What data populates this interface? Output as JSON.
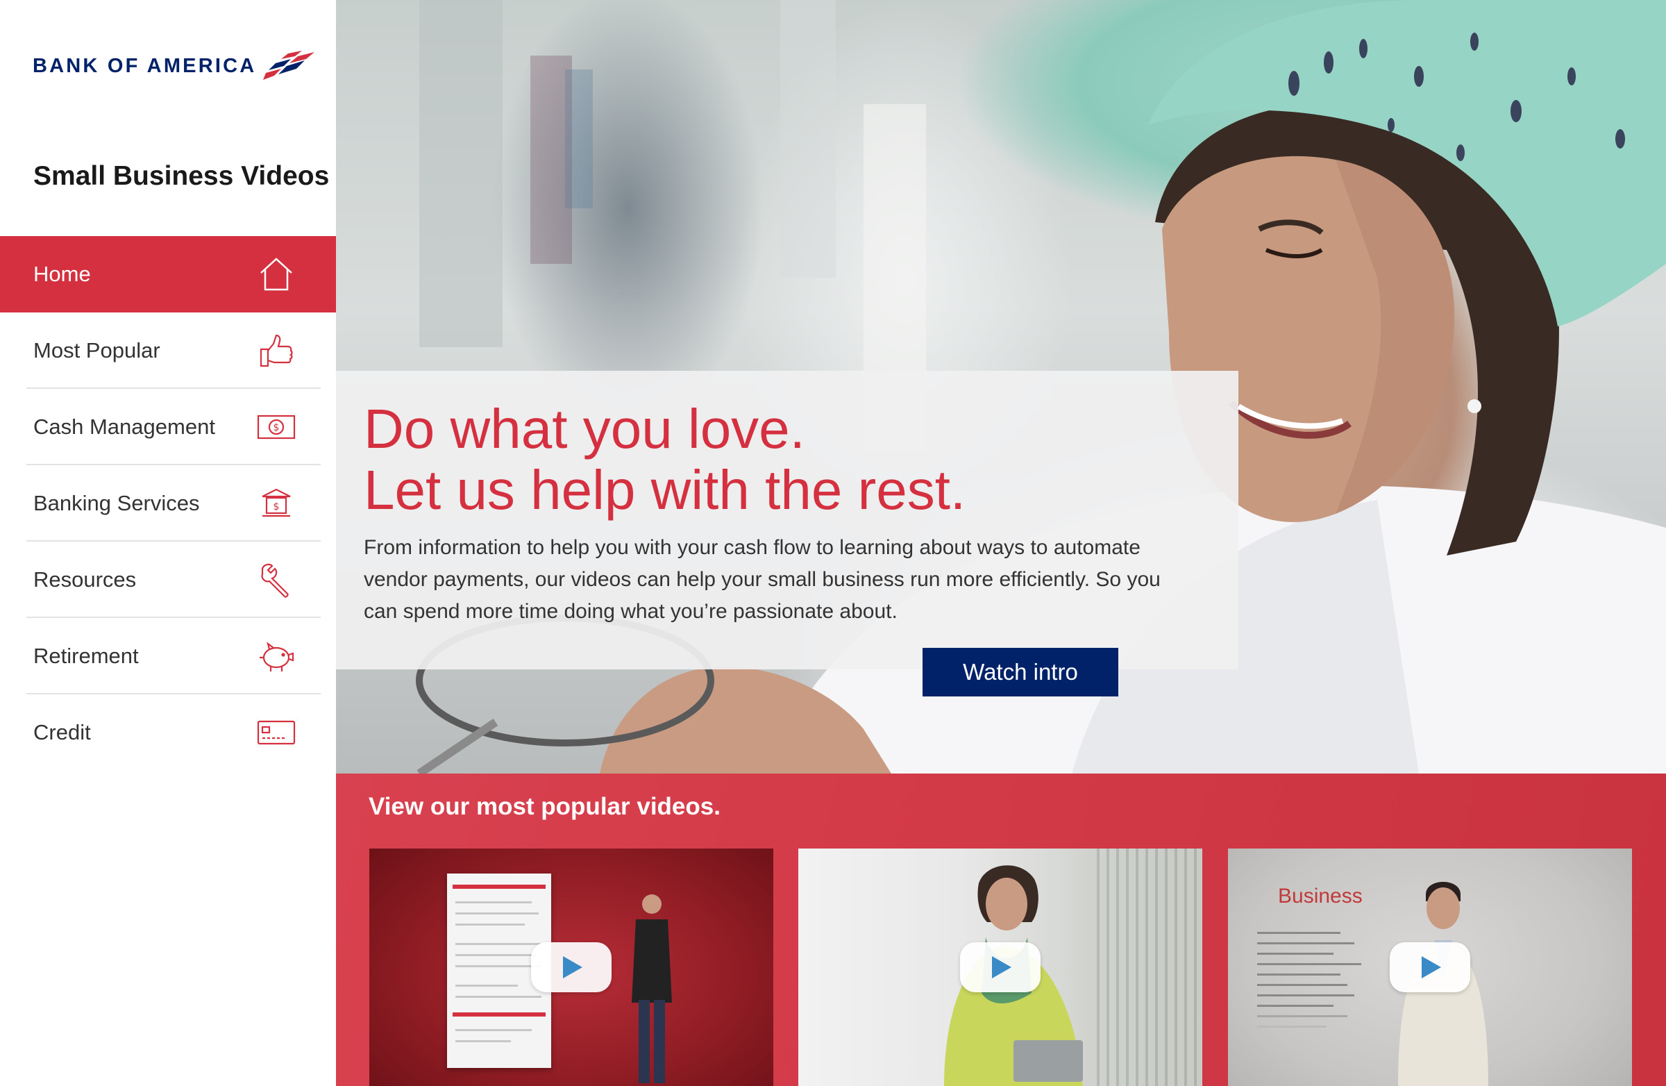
{
  "brand": {
    "name": "BANK OF AMERICA"
  },
  "sidebar": {
    "title": "Small Business Videos",
    "items": [
      {
        "label": "Home",
        "icon": "home-icon",
        "active": true
      },
      {
        "label": "Most Popular",
        "icon": "thumbs-up-icon",
        "active": false
      },
      {
        "label": "Cash Management",
        "icon": "cash-icon",
        "active": false
      },
      {
        "label": "Banking Services",
        "icon": "bank-icon",
        "active": false
      },
      {
        "label": "Resources",
        "icon": "wrench-icon",
        "active": false
      },
      {
        "label": "Retirement",
        "icon": "piggy-bank-icon",
        "active": false
      },
      {
        "label": "Credit",
        "icon": "credit-card-icon",
        "active": false
      }
    ]
  },
  "hero": {
    "headline_line1": "Do what you love.",
    "headline_line2": "Let us help with the rest.",
    "body": "From information to help you with your cash flow to learning about ways to automate vendor payments, our videos can help your small business run more efficiently. So you can spend more time doing what you’re passionate about.",
    "cta": "Watch intro"
  },
  "popular": {
    "title": "View our most popular videos.",
    "videos": [
      {
        "thumbnail": "man-with-invoice"
      },
      {
        "thumbnail": "woman-at-register"
      },
      {
        "thumbnail": "man-with-business-list",
        "overlay_title": "Business"
      }
    ]
  },
  "colors": {
    "brand_red": "#d4303f",
    "brand_navy": "#012169",
    "band_red": "#d33a48"
  }
}
